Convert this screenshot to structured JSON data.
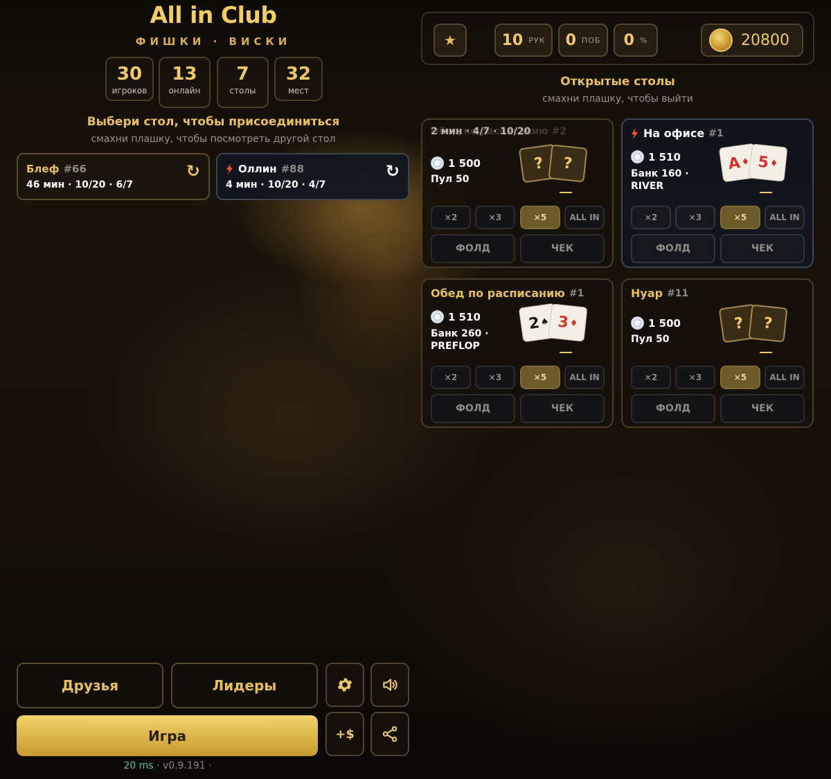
{
  "header": {
    "title": "All in Club",
    "subtitle": "ФИШКИ · ВИСКИ"
  },
  "stats": [
    {
      "value": "30",
      "label": "игроков"
    },
    {
      "value": "13",
      "label": "онлайн"
    },
    {
      "value": "7",
      "label": "столы"
    },
    {
      "value": "32",
      "label": "мест"
    }
  ],
  "join_hint": {
    "title": "Выбери стол, чтобы присоединиться",
    "subtitle": "смахни плашку, чтобы посмотреть другой стол"
  },
  "lobby_tabs": [
    {
      "name": "Блеф",
      "number": "#66",
      "meta": "46 мин · 10/20 · 6/7",
      "refresh_icon": "refresh-icon"
    },
    {
      "name": "Оллин",
      "number": "#88",
      "meta": "4 мин · 10/20 · 4/7",
      "refresh_icon": "refresh-icon",
      "badge_icon": "lightning-icon"
    }
  ],
  "topbar": {
    "star_icon": "star-icon",
    "hands": {
      "value": "10",
      "label": "РУК"
    },
    "wins": {
      "value": "0",
      "label": "ПОБ"
    },
    "percent": {
      "value": "0",
      "label": "%"
    },
    "balance": "20800"
  },
  "open_tables": {
    "title": "Открытые столы",
    "subtitle": "смахни плашку, чтобы выйти"
  },
  "tables": [
    {
      "name": "",
      "number": "",
      "ghost": "2 мин · 4/7 · 10/20",
      "ghost_behind": "Обед по расписанию #2",
      "chips": "1 500",
      "info1": "Пул 50",
      "info2": "",
      "cards": [
        {
          "rank": "?",
          "suit": ""
        },
        {
          "rank": "?",
          "suit": ""
        }
      ],
      "bets": [
        "×2",
        "×3",
        "×5",
        "ALL IN"
      ],
      "fold": "ФОЛД",
      "check": "ЧЕК"
    },
    {
      "name": "На офисе",
      "number": "#1",
      "chips": "1 510",
      "info1": "Банк 160 ·",
      "info2": "RIVER",
      "cards": [
        {
          "rank": "A",
          "suit": "♦"
        },
        {
          "rank": "5",
          "suit": "♦"
        }
      ],
      "bets": [
        "×2",
        "×3",
        "×5",
        "ALL IN"
      ],
      "fold": "ФОЛД",
      "check": "ЧЕК"
    },
    {
      "name": "Обед по расписанию",
      "number": "#1",
      "chips": "1 510",
      "info1": "Банк 260 ·",
      "info2": "PREFLOP",
      "cards": [
        {
          "rank": "2",
          "suit": "♠"
        },
        {
          "rank": "3",
          "suit": "♦"
        }
      ],
      "bets": [
        "×2",
        "×3",
        "×5",
        "ALL IN"
      ],
      "fold": "ФОЛД",
      "check": "ЧЕК"
    },
    {
      "name": "Нуар",
      "number": "#11",
      "chips": "1 500",
      "info1": "Пул 50",
      "info2": "",
      "cards": [
        {
          "rank": "?",
          "suit": ""
        },
        {
          "rank": "?",
          "suit": ""
        }
      ],
      "bets": [
        "×2",
        "×3",
        "×5",
        "ALL IN"
      ],
      "fold": "ФОЛД",
      "check": "ЧЕК"
    }
  ],
  "bottom": {
    "friends": "Друзья",
    "leaders": "Лидеры",
    "play": "Игра",
    "add_money": "+$",
    "settings_icon": "gear-icon",
    "sound_icon": "speaker-icon",
    "share_icon": "share-icon"
  },
  "footer": {
    "ping": "20 ms",
    "version": "· v0.9.191 ·"
  }
}
